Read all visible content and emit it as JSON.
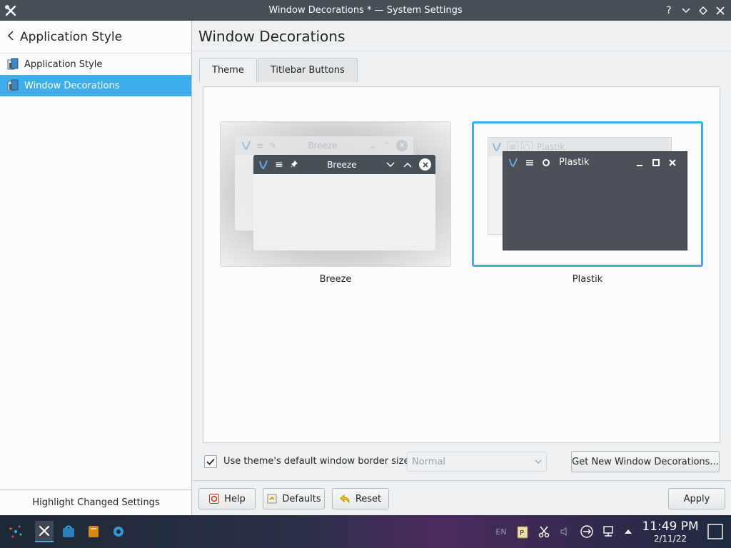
{
  "window": {
    "title": "Window Decorations * — System Settings",
    "buttons": [
      "?",
      "⌄",
      "◇",
      "✕"
    ]
  },
  "sidebar": {
    "back_label": "Application Style",
    "items": [
      {
        "label": "Application Style",
        "selected": false
      },
      {
        "label": "Window Decorations",
        "selected": true
      }
    ],
    "highlight_label": "Highlight Changed Settings"
  },
  "main": {
    "title": "Window Decorations",
    "tabs": [
      {
        "label": "Theme",
        "active": true
      },
      {
        "label": "Titlebar Buttons",
        "active": false
      }
    ],
    "themes": [
      {
        "name": "Breeze",
        "preview_title": "Breeze",
        "back_title": "Breeze",
        "selected": false
      },
      {
        "name": "Plastik",
        "preview_title": "Plastik",
        "back_title": "Plastik",
        "selected": true
      }
    ],
    "border_checkbox_label": "Use theme's default window border size",
    "border_checked": true,
    "border_size_value": "Normal",
    "get_new_label": "Get New Window Decorations..."
  },
  "footer": {
    "help_label": "Help",
    "defaults_label": "Defaults",
    "reset_label": "Reset",
    "apply_label": "Apply"
  },
  "taskbar": {
    "keyboard_layout": "EN",
    "time": "11:49 PM",
    "date": "2/11/22"
  },
  "colors": {
    "accent": "#3daee9",
    "titlebar": "#475057"
  }
}
